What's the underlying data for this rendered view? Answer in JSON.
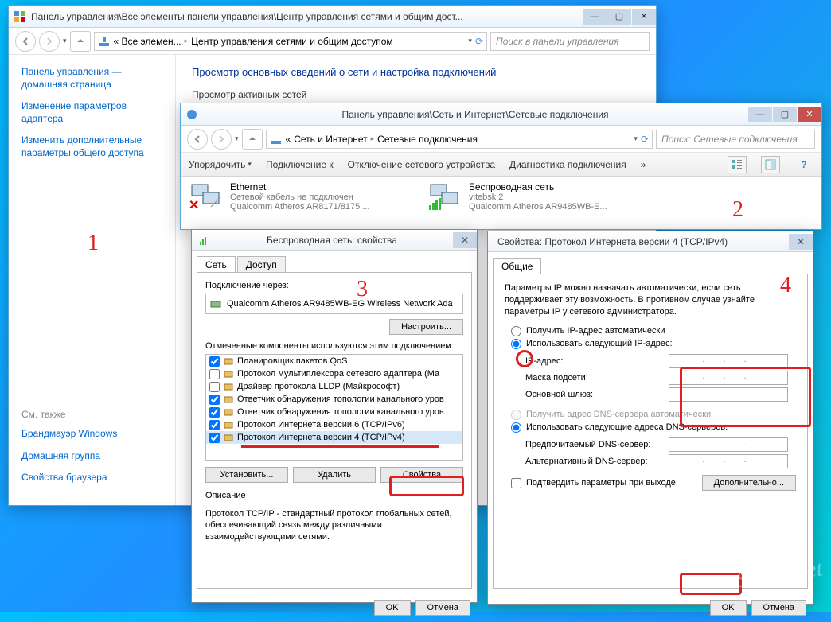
{
  "window1": {
    "title": "Панель управления\\Все элементы панели управления\\Центр управления сетями и общим дост...",
    "breadcrumb": {
      "pre": "« Все элемен...",
      "cur": "Центр управления сетями и общим доступом"
    },
    "search_placeholder": "Поиск в панели управления",
    "sidebar": {
      "home": "Панель управления — домашняя страница",
      "link1": "Изменение параметров адаптера",
      "link2": "Изменить дополнительные параметры общего доступа",
      "seealso_label": "См. также",
      "seealso1": "Брандмауэр Windows",
      "seealso2": "Домашняя группа",
      "seealso3": "Свойства браузера"
    },
    "main": {
      "heading": "Просмотр основных сведений о сети и настройка подключений",
      "sub": "Просмотр активных сетей"
    }
  },
  "window2": {
    "title": "Панель управления\\Сеть и Интернет\\Сетевые подключения",
    "breadcrumb": {
      "b1": "Сеть и Интернет",
      "b2": "Сетевые подключения"
    },
    "search_placeholder": "Поиск: Сетевые подключения",
    "toolbar": {
      "organize": "Упорядочить",
      "connect": "Подключение к",
      "disable": "Отключение сетевого устройства",
      "diagnose": "Диагностика подключения"
    },
    "conn1": {
      "name": "Ethernet",
      "status": "Сетевой кабель не подключен",
      "device": "Qualcomm Atheros AR8171/8175 ..."
    },
    "conn2": {
      "name": "Беспроводная сеть",
      "status": "vitebsk  2",
      "device": "Qualcomm Atheros AR9485WB-E..."
    }
  },
  "dialog3": {
    "title": "Беспроводная сеть: свойства",
    "tabs": {
      "net": "Сеть",
      "access": "Доступ"
    },
    "connect_via": "Подключение через:",
    "adapter": "Qualcomm Atheros AR9485WB-EG Wireless Network Ada",
    "configure": "Настроить...",
    "components_label": "Отмеченные компоненты используются этим подключением:",
    "components": [
      {
        "checked": true,
        "label": "Планировщик пакетов QoS"
      },
      {
        "checked": false,
        "label": "Протокол мультиплексора сетевого адаптера (Ма"
      },
      {
        "checked": false,
        "label": "Драйвер протокола LLDP (Майкрософт)"
      },
      {
        "checked": true,
        "label": "Ответчик обнаружения топологии канального уров"
      },
      {
        "checked": true,
        "label": "Ответчик обнаружения топологии канального уров"
      },
      {
        "checked": true,
        "label": "Протокол Интернета версии 6 (TCP/IPv6)"
      },
      {
        "checked": true,
        "label": "Протокол Интернета версии 4 (TCP/IPv4)"
      }
    ],
    "install": "Установить...",
    "remove": "Удалить",
    "properties": "Свойства",
    "desc_label": "Описание",
    "desc": "Протокол TCP/IP - стандартный протокол глобальных сетей, обеспечивающий связь между различными взаимодействующими сетями.",
    "ok": "OK",
    "cancel": "Отмена"
  },
  "dialog4": {
    "title": "Свойства: Протокол Интернета версии 4 (TCP/IPv4)",
    "tab": "Общие",
    "intro": "Параметры IP можно назначать автоматически, если сеть поддерживает эту возможность. В противном случае узнайте параметры IP у сетевого администратора.",
    "radio_auto_ip": "Получить IP-адрес автоматически",
    "radio_manual_ip": "Использовать следующий IP-адрес:",
    "ip_label": "IP-адрес:",
    "mask_label": "Маска подсети:",
    "gateway_label": "Основной шлюз:",
    "radio_auto_dns": "Получить адрес DNS-сервера автоматически",
    "radio_manual_dns": "Использовать следующие адреса DNS-серверов:",
    "dns1_label": "Предпочитаемый DNS-сервер:",
    "dns2_label": "Альтернативный DNS-сервер:",
    "confirm_exit": "Подтвердить параметры при выходе",
    "advanced": "Дополнительно...",
    "ok": "OK",
    "cancel": "Отмена",
    "dots": ".   .   ."
  },
  "annotations": {
    "n1": "1",
    "n2": "2",
    "n3": "3",
    "n4": "4"
  },
  "watermark": "SamoSvet"
}
